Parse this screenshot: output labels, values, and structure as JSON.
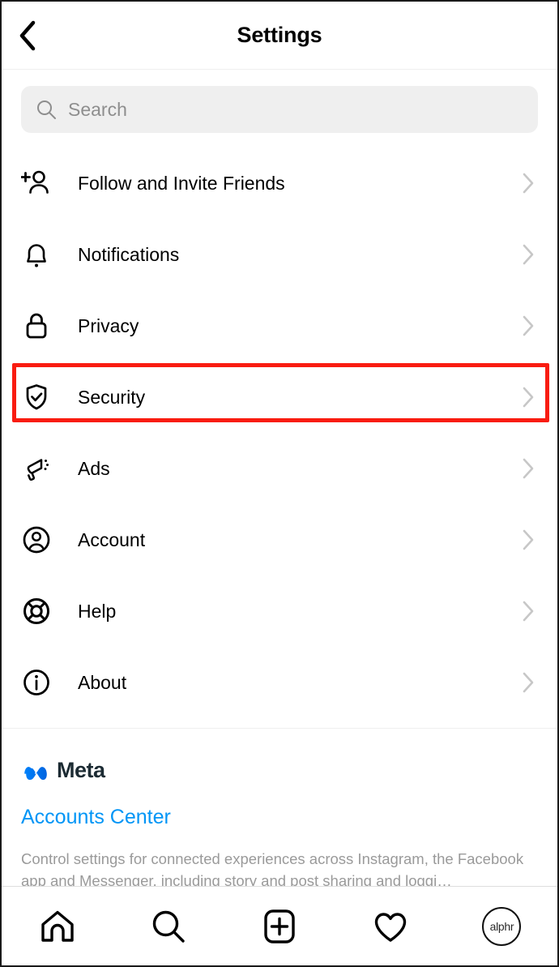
{
  "header": {
    "title": "Settings",
    "back_icon": "chevron-left-icon"
  },
  "search": {
    "placeholder": "Search",
    "value": "",
    "icon": "search-icon"
  },
  "settings_list": {
    "items": [
      {
        "label": "Follow and Invite Friends",
        "icon": "add-person-icon",
        "chevron": "chevron-right-icon",
        "highlighted": false
      },
      {
        "label": "Notifications",
        "icon": "bell-icon",
        "chevron": "chevron-right-icon",
        "highlighted": false
      },
      {
        "label": "Privacy",
        "icon": "lock-icon",
        "chevron": "chevron-right-icon",
        "highlighted": false
      },
      {
        "label": "Security",
        "icon": "shield-check-icon",
        "chevron": "chevron-right-icon",
        "highlighted": true
      },
      {
        "label": "Ads",
        "icon": "megaphone-icon",
        "chevron": "chevron-right-icon",
        "highlighted": false
      },
      {
        "label": "Account",
        "icon": "person-circle-icon",
        "chevron": "chevron-right-icon",
        "highlighted": false
      },
      {
        "label": "Help",
        "icon": "life-ring-icon",
        "chevron": "chevron-right-icon",
        "highlighted": false
      },
      {
        "label": "About",
        "icon": "info-circle-icon",
        "chevron": "chevron-right-icon",
        "highlighted": false
      }
    ]
  },
  "meta_section": {
    "brand_icon": "meta-infinity-logo",
    "brand_name": "Meta",
    "accounts_center_label": "Accounts Center",
    "description": "Control settings for connected experiences across Instagram, the Facebook app and Messenger, including story and post sharing and loggi…"
  },
  "bottom_nav": {
    "items": [
      {
        "name": "home",
        "icon": "home-icon"
      },
      {
        "name": "search",
        "icon": "search-icon"
      },
      {
        "name": "create",
        "icon": "plus-square-icon"
      },
      {
        "name": "activity",
        "icon": "heart-icon"
      },
      {
        "name": "profile",
        "icon": "avatar-icon",
        "avatar_text": "alphr"
      }
    ]
  },
  "colors": {
    "highlight": "#f91c11",
    "link": "#0095f6",
    "meta_blue": "#0081fb",
    "placeholder": "#8e8e8e",
    "chevron": "#c7c7c7",
    "search_bg": "#efefef"
  }
}
